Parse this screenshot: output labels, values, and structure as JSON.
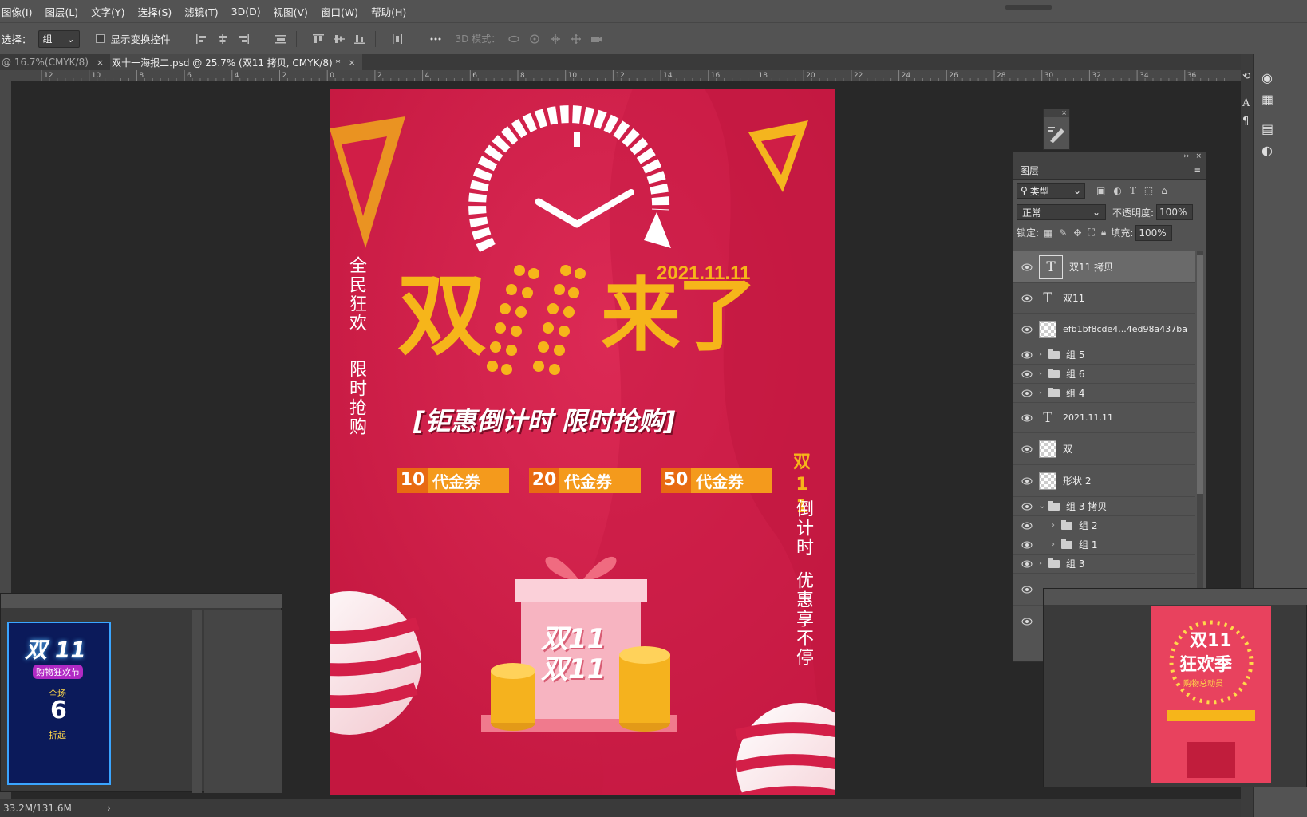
{
  "menu": [
    "图像(I)",
    "图层(L)",
    "文字(Y)",
    "选择(S)",
    "滤镜(T)",
    "3D(D)",
    "视图(V)",
    "窗口(W)",
    "帮助(H)"
  ],
  "options": {
    "label": "选择：",
    "select_value": "组",
    "checkbox_label": "显示变换控件",
    "mode_3d": "3D 模式："
  },
  "tabs": [
    {
      "label": "@ 16.7%(CMYK/8)",
      "close": "×"
    },
    {
      "label": "双十一海报二.psd @ 25.7% (双11 拷贝, CMYK/8) *",
      "close": "×"
    }
  ],
  "ruler_ticks": [
    "12",
    "10",
    "8",
    "6",
    "4",
    "2",
    "0",
    "2",
    "4",
    "6",
    "8",
    "10",
    "12",
    "14",
    "16",
    "18",
    "20",
    "22",
    "24",
    "26",
    "28",
    "30",
    "32",
    "34",
    "36"
  ],
  "poster": {
    "date": "2021.11.11",
    "title_left": "双",
    "title_mid": "11",
    "title_right": "来了",
    "subtitle": "[钜惠倒计时 限时抢购]",
    "left_vertical_1": "全民狂欢",
    "left_vertical_2": "限时抢购",
    "right_vertical_1": "双11",
    "right_vertical_2": "倒计时",
    "right_vertical_3": "优惠享不停",
    "coupons": [
      {
        "amount": "10",
        "label": "代金券"
      },
      {
        "amount": "20",
        "label": "代金券"
      },
      {
        "amount": "50",
        "label": "代金券"
      }
    ],
    "gift_text_1": "双11",
    "gift_text_2": "双11"
  },
  "layers_panel": {
    "title": "图层",
    "filter_label": "类型",
    "blend_mode": "正常",
    "opacity_label": "不透明度:",
    "opacity_value": "100%",
    "lock_label": "锁定:",
    "fill_label": "填充:",
    "fill_value": "100%",
    "layers": [
      {
        "name": "双11 拷贝",
        "kind": "text"
      },
      {
        "name": "双11",
        "kind": "text"
      },
      {
        "name": "efb1bf8cde4...4ed98a437ba",
        "kind": "image"
      },
      {
        "name": "组 5",
        "kind": "group"
      },
      {
        "name": "组 6",
        "kind": "group"
      },
      {
        "name": "组 4",
        "kind": "group"
      },
      {
        "name": "2021.11.11",
        "kind": "text"
      },
      {
        "name": "双",
        "kind": "shape"
      },
      {
        "name": "形状 2",
        "kind": "shape"
      },
      {
        "name": "组 3 拷贝",
        "kind": "group-open"
      },
      {
        "name": "组 2",
        "kind": "group"
      },
      {
        "name": "组 1",
        "kind": "group"
      },
      {
        "name": "组 3",
        "kind": "group"
      }
    ]
  },
  "status": {
    "doc_size": "33.2M/131.6M",
    "arrow": "›"
  },
  "thumb_left": {
    "title": "双 11",
    "sub": "购物狂欢节",
    "num": "6",
    "foot": "折起",
    "label": "全场"
  },
  "thumb_right": {
    "title": "双11",
    "sub": "狂欢季",
    "tag": "购物总动员"
  },
  "colors": {
    "poster_bg": "#d31f48",
    "gold": "#f6b51a",
    "ui_bg": "#535353",
    "canvas_bg": "#282828"
  }
}
